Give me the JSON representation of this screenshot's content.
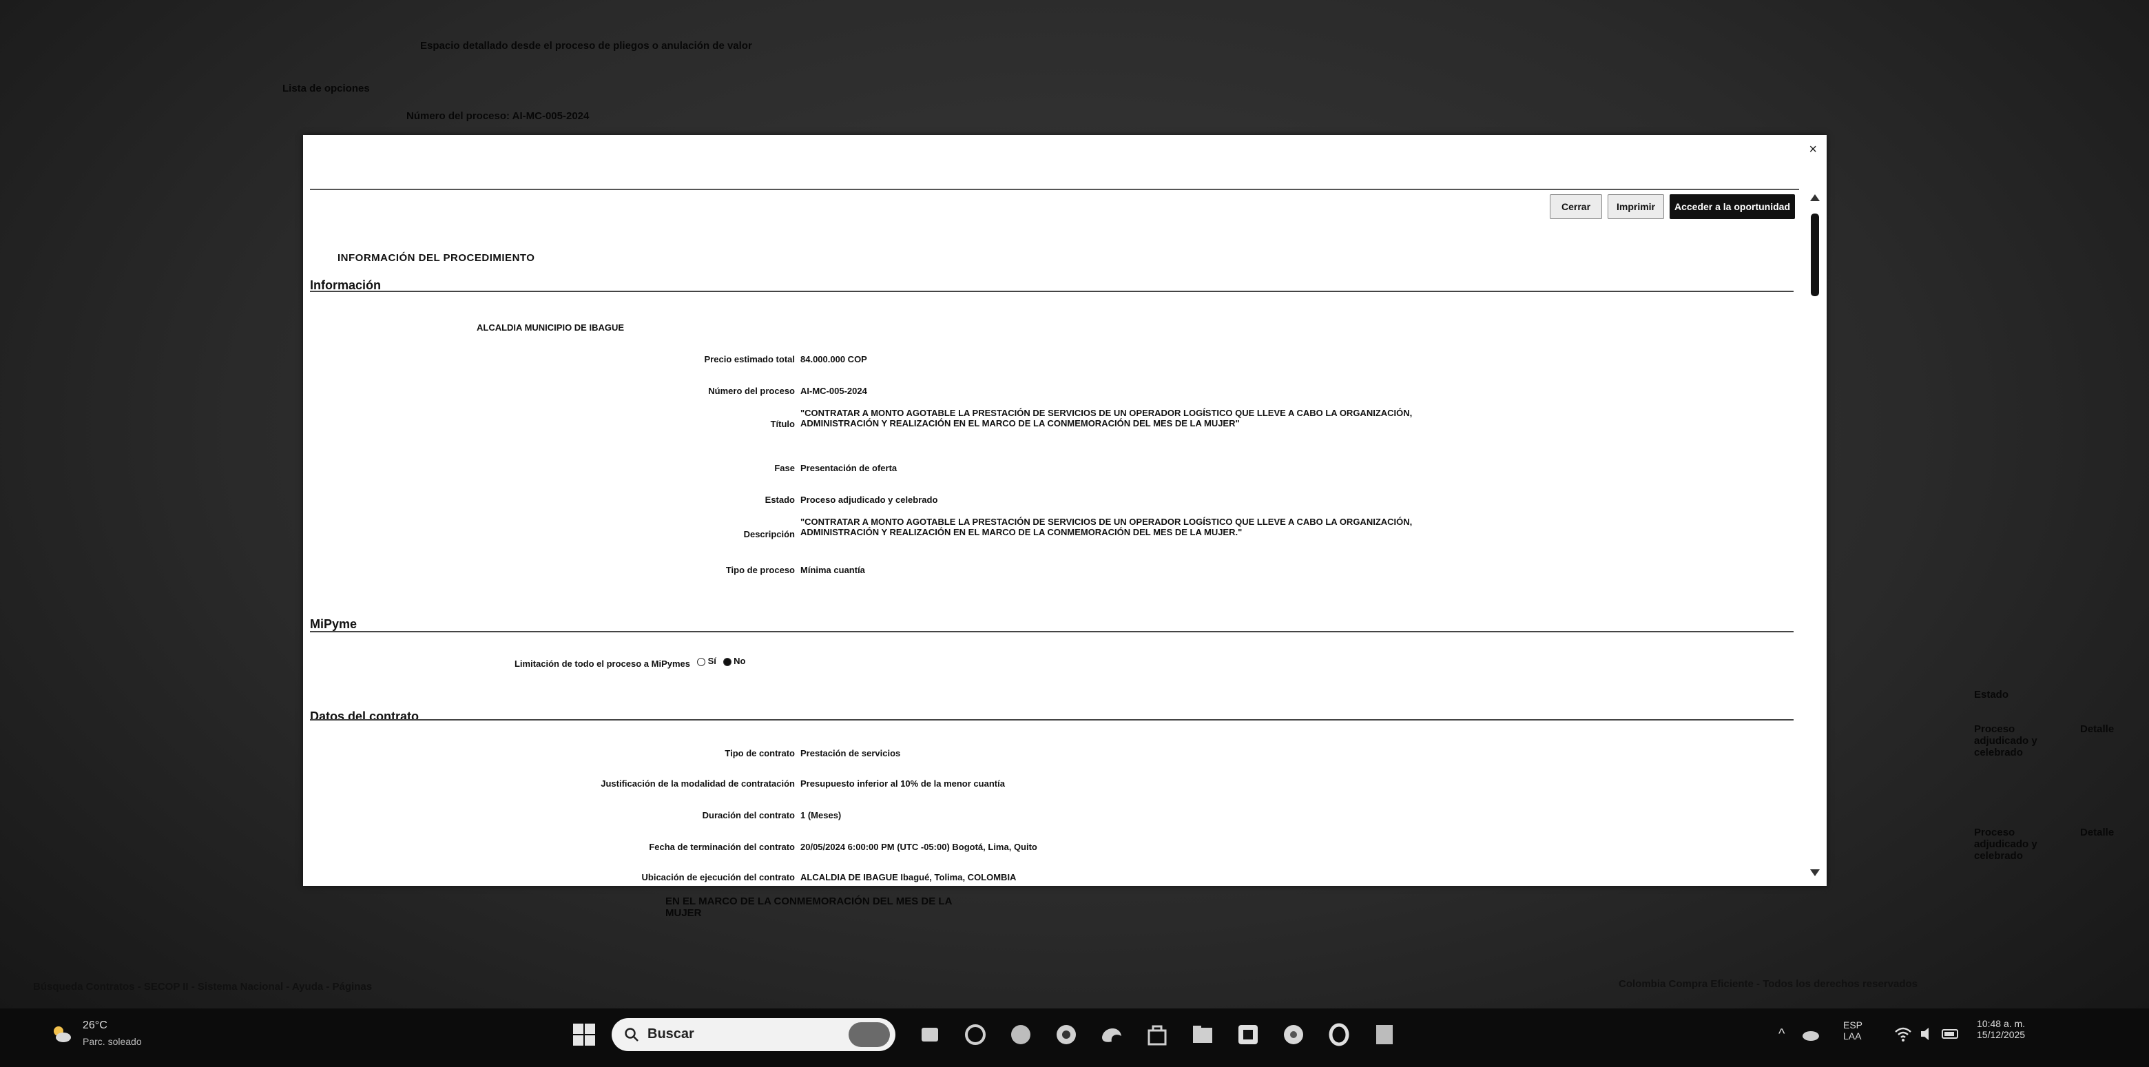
{
  "background": {
    "line1": "Espacio detallado desde el proceso de pliegos o anulación de valor",
    "line2": "Lista de opciones",
    "line3": "Número del proceso: AI-MC-005-2024",
    "bottom_left": "Búsqueda Contratos - SECOP II - Sistema Nacional - Ayuda - Páginas",
    "bottom_right": "Colombia Compra Eficiente - Todos los derechos reservados",
    "under_modal": "EN EL MARCO DE LA CONMEMORACIÓN DEL MES DE LA MUJER"
  },
  "modal": {
    "close_label": "×",
    "buttons": {
      "cerrar": "Cerrar",
      "imprimir": "Imprimir",
      "accion": "Acceder a la oportunidad"
    },
    "heading": "INFORMACIÓN DEL PROCEDIMIENTO",
    "sections": {
      "informacion": "Información",
      "mipymes": "MiPyme",
      "datos_contrato": "Datos del contrato"
    },
    "entity": "ALCALDIA MUNICIPIO DE IBAGUE",
    "fields": {
      "precio_label": "Precio estimado total",
      "precio_value": "84.000.000 COP",
      "numero_label": "Número del proceso",
      "numero_value": "AI-MC-005-2024",
      "titulo_label": "Título",
      "titulo_value": "\"CONTRATAR A MONTO AGOTABLE LA PRESTACIÓN DE SERVICIOS DE UN OPERADOR LOGÍSTICO QUE LLEVE A CABO LA ORGANIZACIÓN, ADMINISTRACIÓN Y REALIZACIÓN EN EL MARCO DE LA CONMEMORACIÓN DEL MES DE LA MUJER\"",
      "fase_label": "Fase",
      "fase_value": "Presentación de oferta",
      "estado_label": "Estado",
      "estado_value": "Proceso adjudicado y celebrado",
      "descripcion_label": "Descripción",
      "descripcion_value": "\"CONTRATAR A MONTO AGOTABLE LA PRESTACIÓN DE SERVICIOS DE UN OPERADOR LOGÍSTICO QUE LLEVE A CABO LA ORGANIZACIÓN, ADMINISTRACIÓN Y REALIZACIÓN EN EL MARCO DE LA CONMEMORACIÓN DEL MES DE LA MUJER.\"",
      "tipo_proceso_label": "Tipo de proceso",
      "tipo_proceso_value": "Mínima cuantía",
      "limitacion_label": "Limitación de todo el proceso a MiPymes",
      "limitacion_si": "Sí",
      "limitacion_no": "No",
      "tipo_contrato_label": "Tipo de contrato",
      "tipo_contrato_value": "Prestación de servicios",
      "justificacion_label": "Justificación de la modalidad de contratación",
      "justificacion_value": "Presupuesto inferior al 10% de la menor cuantía",
      "duracion_label": "Duración del contrato",
      "duracion_value": "1 (Meses)",
      "fecha_label": "Fecha de terminación del contrato",
      "fecha_value": "20/05/2024 6:00:00 PM (UTC -05:00) Bogotá, Lima, Quito",
      "ubicacion_label": "Ubicación de ejecución del contrato",
      "ubicacion_value": "ALCALDIA DE IBAGUE Ibagué, Tolima, COLOMBIA"
    }
  },
  "right_panel": {
    "header": "Estado",
    "row1_a": "Proceso adjudicado y celebrado",
    "row1_b": "Detalle",
    "row2_a": "Proceso adjudicado y celebrado",
    "row2_b": "Detalle"
  },
  "taskbar": {
    "temp": "26°C",
    "weather": "Parc. soleado",
    "search_placeholder": "Buscar",
    "lang_line1": "ESP",
    "lang_line2": "LAA",
    "time": "10:48 a. m.",
    "date": "15/12/2025"
  },
  "colors": {
    "accent_button": "#111111",
    "taskbar": "#0c0c0c"
  }
}
